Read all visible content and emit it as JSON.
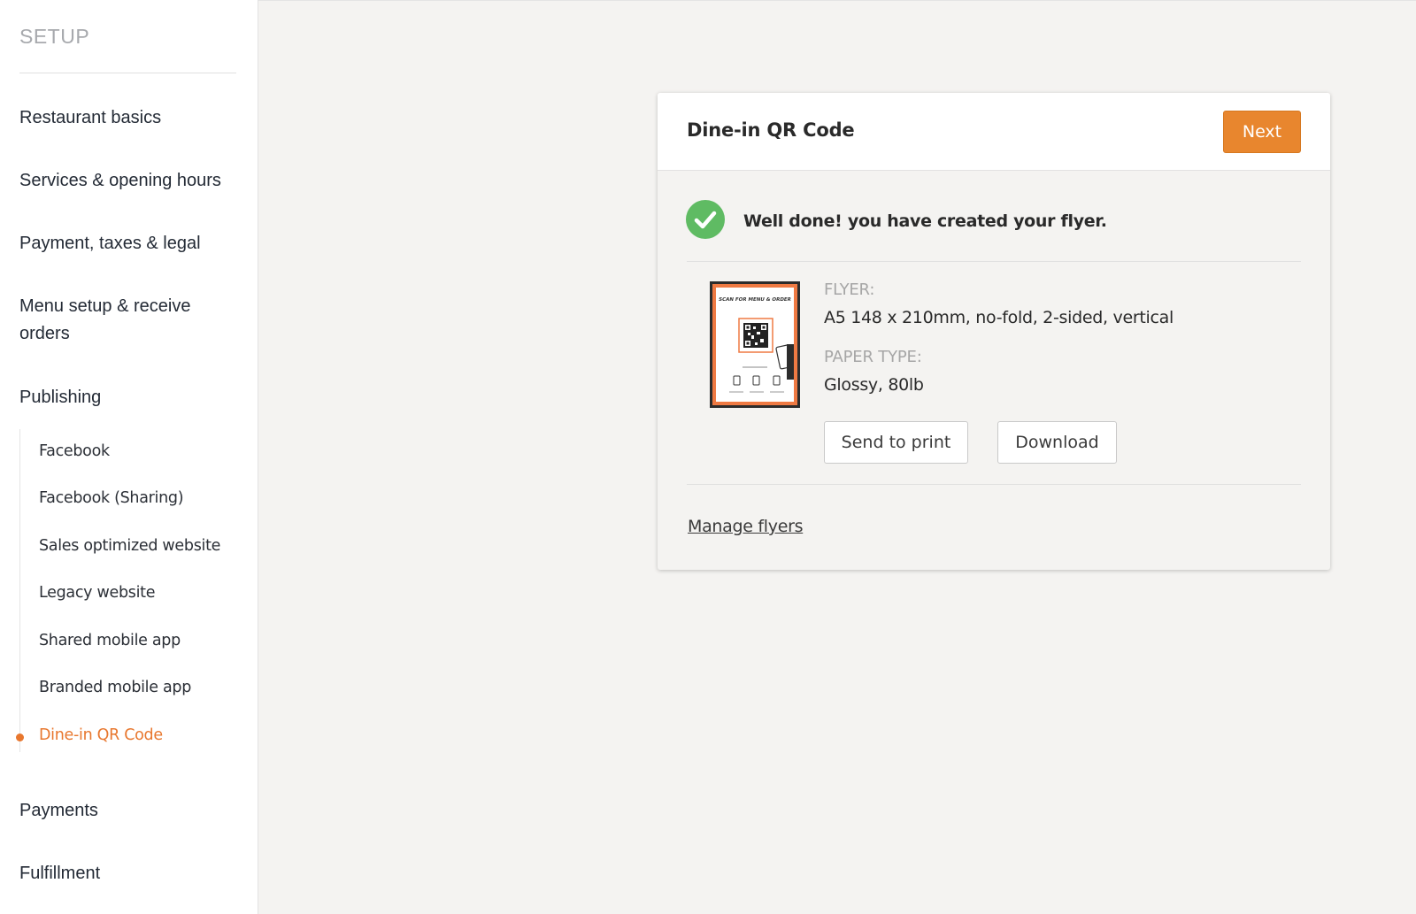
{
  "sidebar": {
    "title": "SETUP",
    "items": [
      {
        "label": "Restaurant basics"
      },
      {
        "label": "Services & opening hours"
      },
      {
        "label": "Payment, taxes & legal"
      },
      {
        "label": "Menu setup & receive orders"
      },
      {
        "label": "Publishing"
      },
      {
        "label": "Payments"
      },
      {
        "label": "Fulfillment"
      }
    ],
    "publishing_subitems": [
      {
        "label": "Facebook"
      },
      {
        "label": "Facebook (Sharing)"
      },
      {
        "label": "Sales optimized website"
      },
      {
        "label": "Legacy website"
      },
      {
        "label": "Shared mobile app"
      },
      {
        "label": "Branded mobile app"
      },
      {
        "label": "Dine-in QR Code",
        "active": true
      }
    ],
    "active_color": "#e8772e"
  },
  "card": {
    "title": "Dine-in QR Code",
    "next_label": "Next",
    "success_message": "Well done! you have created your flyer.",
    "flyer_label": "FLYER:",
    "flyer_value": "A5 148 x 210mm, no-fold, 2-sided, vertical",
    "paper_label": "PAPER TYPE:",
    "paper_value": "Glossy, 80lb",
    "send_to_print_label": "Send to print",
    "download_label": "Download",
    "manage_flyers_label": "Manage flyers",
    "thumbnail_heading": "SCAN FOR MENU & ORDER"
  },
  "colors": {
    "accent": "#e8862e",
    "success": "#5fbb63",
    "background": "#f4f3f1"
  }
}
